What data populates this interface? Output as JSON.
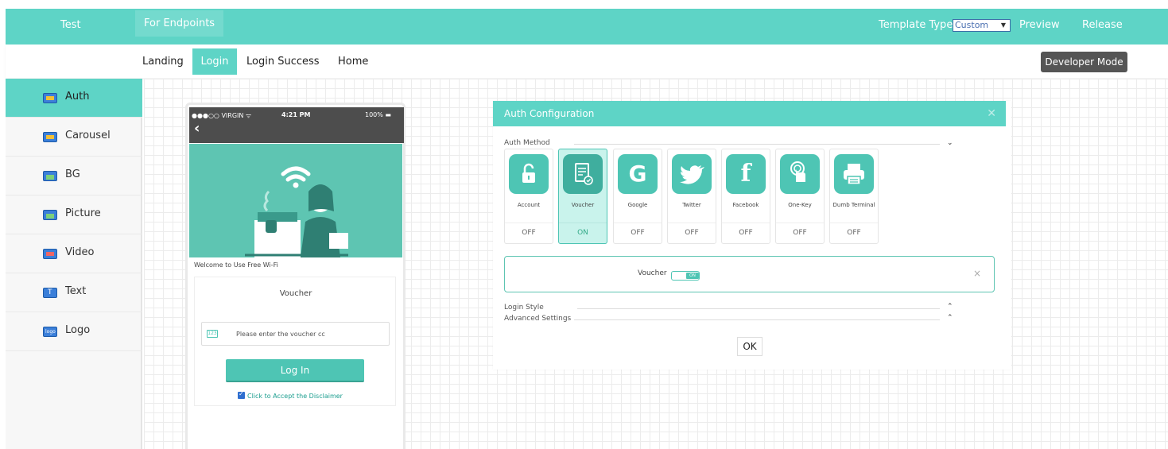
{
  "topbar": {
    "tabs": [
      "Test",
      "For Endpoints"
    ],
    "template_type_label": "Template Type",
    "template_type_value": "Custom",
    "preview": "Preview",
    "release": "Release"
  },
  "subbar": {
    "tabs": [
      "Landing",
      "Login",
      "Login Success",
      "Home"
    ],
    "active_tab": "Login",
    "developer_mode": "Developer Mode"
  },
  "sidebar": {
    "items": [
      {
        "label": "Auth",
        "icon": "auth-icon"
      },
      {
        "label": "Carousel",
        "icon": "carousel-icon"
      },
      {
        "label": "BG",
        "icon": "background-image-icon"
      },
      {
        "label": "Picture",
        "icon": "picture-icon"
      },
      {
        "label": "Video",
        "icon": "video-icon"
      },
      {
        "label": "Text",
        "icon": "text-icon"
      },
      {
        "label": "Logo",
        "icon": "logo-icon"
      }
    ],
    "active": "Auth"
  },
  "phone": {
    "carrier": "●●●○○ VIRGIN ᯤ",
    "time": "4:21 PM",
    "battery": "100% ▬",
    "welcome": "Welcome to Use Free Wi-Fi",
    "card_title": "Voucher",
    "voucher_placeholder": "Please enter the voucher cc",
    "login_button": "Log In",
    "disclaimer": "Click to Accept the Disclaimer"
  },
  "panel": {
    "title": "Auth Configuration",
    "auth_method_label": "Auth Method",
    "methods": [
      {
        "label": "Account",
        "state": "OFF",
        "icon": "lock-icon"
      },
      {
        "label": "Voucher",
        "state": "ON",
        "icon": "voucher-icon"
      },
      {
        "label": "Google",
        "state": "OFF",
        "icon": "google-icon"
      },
      {
        "label": "Twitter",
        "state": "OFF",
        "icon": "twitter-icon"
      },
      {
        "label": "Facebook",
        "state": "OFF",
        "icon": "facebook-icon"
      },
      {
        "label": "One-Key",
        "state": "OFF",
        "icon": "one-key-icon"
      },
      {
        "label": "Dumb Terminal",
        "state": "OFF",
        "icon": "printer-icon"
      }
    ],
    "voucher_row": {
      "label": "Voucher",
      "toggle": "ON"
    },
    "login_style_label": "Login Style",
    "advanced_settings_label": "Advanced Settings",
    "ok_button": "OK"
  },
  "colors": {
    "accent": "#5ed4c6",
    "accent_dark": "#4ec5b4",
    "developer_button": "#555555"
  }
}
